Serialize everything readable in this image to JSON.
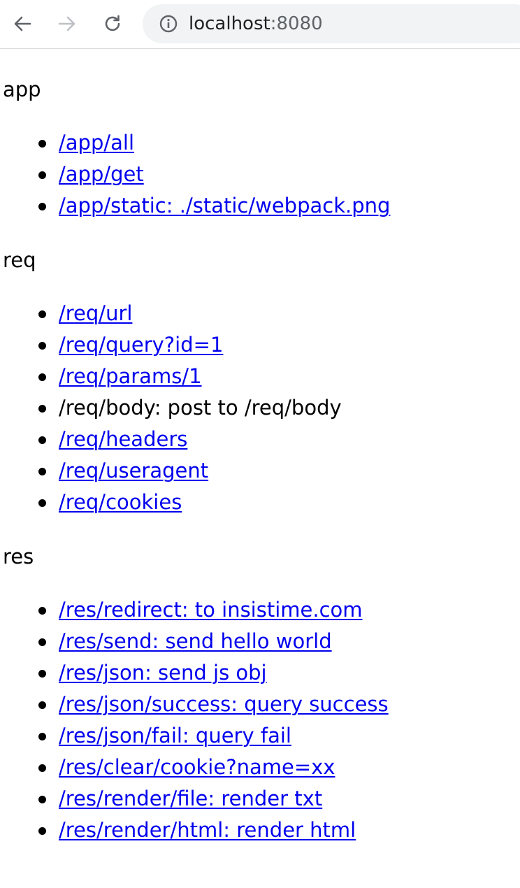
{
  "browser": {
    "url_host": "localhost",
    "url_port": ":8080",
    "icons": {
      "back": "back-arrow-icon",
      "forward": "forward-arrow-icon",
      "reload": "reload-icon",
      "info": "info-icon"
    }
  },
  "sections": {
    "app": {
      "title": "app",
      "items": [
        {
          "text": "/app/all",
          "link": true
        },
        {
          "text": "/app/get",
          "link": true
        },
        {
          "text": "/app/static: ./static/webpack.png",
          "link": true
        }
      ]
    },
    "req": {
      "title": "req",
      "items": [
        {
          "text": "/req/url",
          "link": true
        },
        {
          "text": "/req/query?id=1",
          "link": true
        },
        {
          "text": "/req/params/1",
          "link": true
        },
        {
          "text": "/req/body: post to /req/body",
          "link": false
        },
        {
          "text": "/req/headers",
          "link": true
        },
        {
          "text": "/req/useragent",
          "link": true
        },
        {
          "text": "/req/cookies",
          "link": true
        }
      ]
    },
    "res": {
      "title": "res",
      "items": [
        {
          "text": "/res/redirect: to insistime.com",
          "link": true
        },
        {
          "text": "/res/send: send hello world",
          "link": true
        },
        {
          "text": "/res/json: send js obj",
          "link": true
        },
        {
          "text": "/res/json/success: query success",
          "link": true
        },
        {
          "text": "/res/json/fail: query fail",
          "link": true
        },
        {
          "text": "/res/clear/cookie?name=xx",
          "link": true
        },
        {
          "text": "/res/render/file: render txt",
          "link": true
        },
        {
          "text": "/res/render/html: render html",
          "link": true
        }
      ]
    }
  },
  "colors": {
    "link": "#0000ee",
    "text": "#000000",
    "omnibox_bg": "#f1f3f4"
  }
}
